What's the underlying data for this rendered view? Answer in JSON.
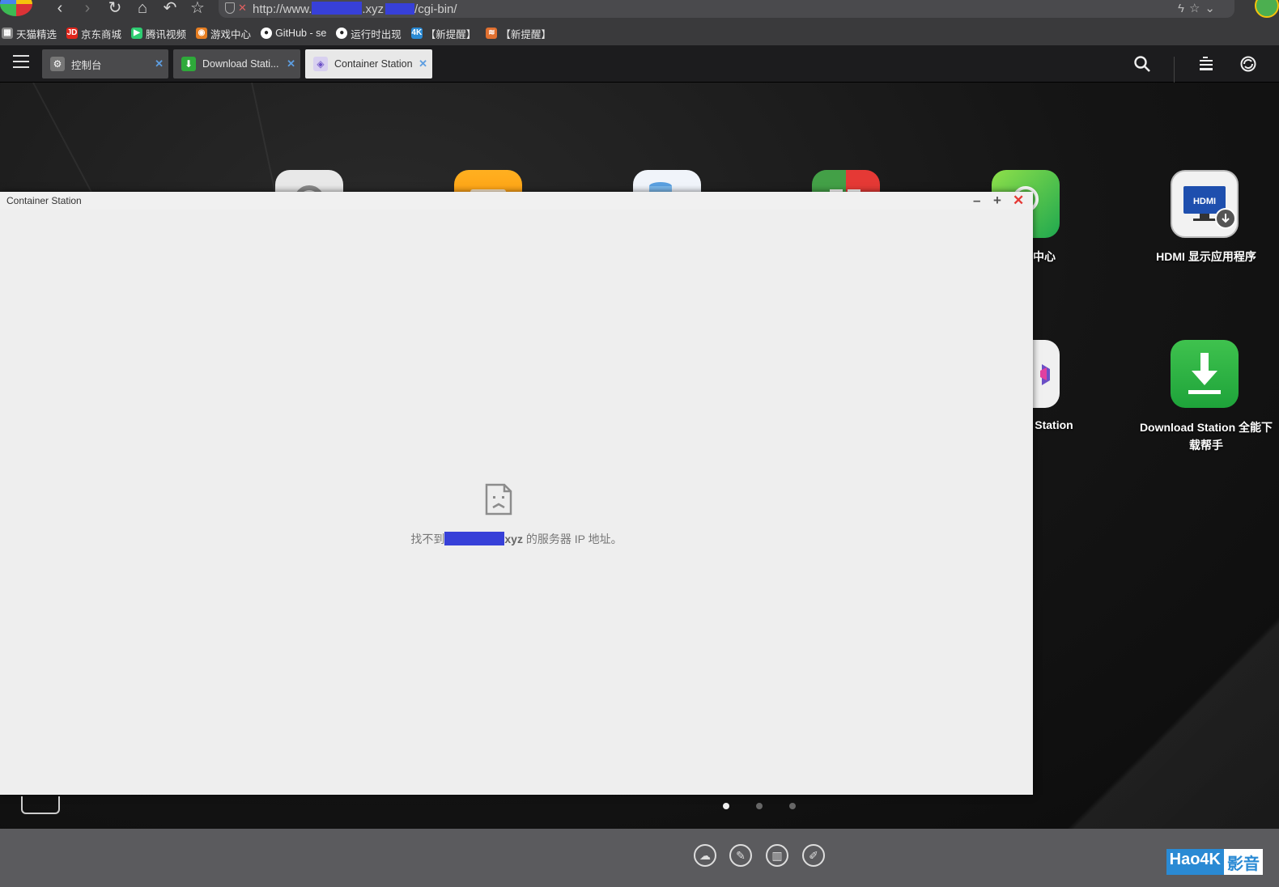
{
  "browser": {
    "url_prefix": "http://www.",
    "url_tld": ".xyz",
    "url_path": "/cgi-bin/",
    "bookmarks": [
      {
        "label": "天猫精选",
        "icon": "tmall-icon",
        "color": "#888888"
      },
      {
        "label": "京东商城",
        "icon": "jd-icon",
        "color": "#e1251b"
      },
      {
        "label": "腾讯视频",
        "icon": "tencent-video-icon",
        "color": "#2ecc71"
      },
      {
        "label": "游戏中心",
        "icon": "gamepad-icon",
        "color": "#e67e22"
      },
      {
        "label": "GitHub - se",
        "icon": "github-icon",
        "color": "#ffffff"
      },
      {
        "label": "运行时出现",
        "icon": "github-icon",
        "color": "#ffffff"
      },
      {
        "label": "【新提醒】",
        "icon": "4k-icon",
        "color": "#2a8ad4"
      },
      {
        "label": "【新提醒】",
        "icon": "site-icon",
        "color": "#e07030"
      }
    ]
  },
  "qts": {
    "tabs": [
      {
        "label": "控制台",
        "icon": "gear-icon"
      },
      {
        "label": "Download Stati...",
        "icon": "download-icon"
      },
      {
        "label": "Container Station",
        "icon": "container-icon"
      }
    ]
  },
  "desktop": {
    "apps": [
      {
        "label": "HDMI 显示应用程序"
      },
      {
        "label": "中心"
      },
      {
        "label": "Station"
      },
      {
        "label": "Download Station 全能下"
      },
      {
        "label": "载帮手"
      }
    ]
  },
  "window": {
    "title": "Container Station",
    "error_prefix": "找不到",
    "error_host_tail": "xyz",
    "error_suffix": " 的服务器 IP 地址。"
  },
  "watermark": {
    "part1": "Hao4K",
    "part2": "影音"
  },
  "colors": {
    "redaction": "#3740d8",
    "close_red": "#e53935"
  }
}
